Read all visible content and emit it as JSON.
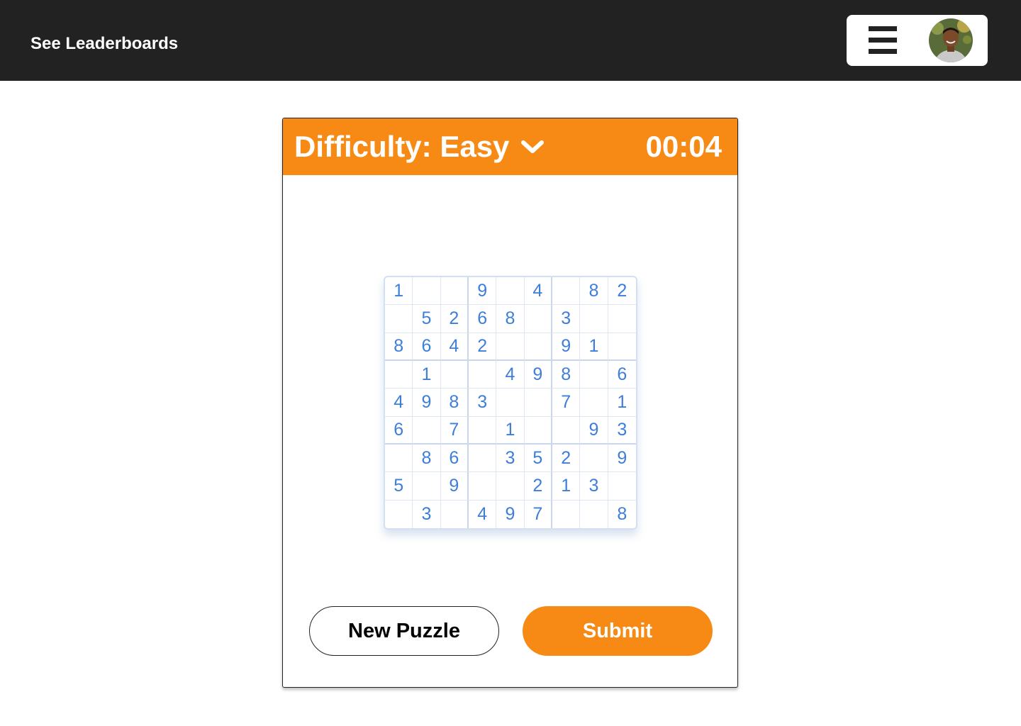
{
  "nav": {
    "leaderboards_label": "See Leaderboards",
    "menu_icon": "hamburger-menu-icon",
    "avatar": "user-avatar"
  },
  "game": {
    "difficulty_label": "Difficulty: Easy",
    "timer": "00:04",
    "chevron_icon": "chevron-down-icon",
    "accent_color": "#f78a14",
    "digit_color": "#3d7edb",
    "grid": [
      [
        "1",
        "",
        "",
        "9",
        "",
        "4",
        "",
        "8",
        "2"
      ],
      [
        "",
        "5",
        "2",
        "6",
        "8",
        "",
        "3",
        "",
        ""
      ],
      [
        "8",
        "6",
        "4",
        "2",
        "",
        "",
        "9",
        "1",
        ""
      ],
      [
        "",
        "1",
        "",
        "",
        "4",
        "9",
        "8",
        "",
        "6"
      ],
      [
        "4",
        "9",
        "8",
        "3",
        "",
        "",
        "7",
        "",
        "1"
      ],
      [
        "6",
        "",
        "7",
        "",
        "1",
        "",
        "",
        "9",
        "3"
      ],
      [
        "",
        "8",
        "6",
        "",
        "3",
        "5",
        "2",
        "",
        "9"
      ],
      [
        "5",
        "",
        "9",
        "",
        "",
        "2",
        "1",
        "3",
        ""
      ],
      [
        "",
        "3",
        "",
        "4",
        "9",
        "7",
        "",
        "",
        "8"
      ]
    ]
  },
  "actions": {
    "new_puzzle_label": "New Puzzle",
    "submit_label": "Submit"
  }
}
